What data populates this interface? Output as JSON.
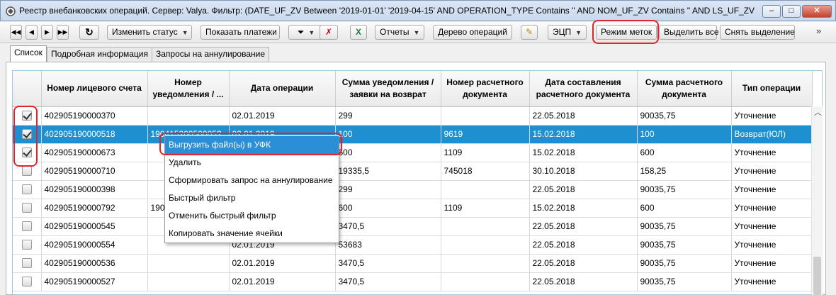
{
  "window": {
    "title": "Реестр внебанковских операций. Сервер: Valya. Фильтр: (DATE_UF_ZV Between '2019-01-01' '2019-04-15' AND OPERATION_TYPE Contains '' AND NOM_UF_ZV Contains '' AND LS_UF_ZV Contai...",
    "minimize": "‒",
    "maximize": "□",
    "close": "✕"
  },
  "toolbar": {
    "first": "◀◀",
    "prev": "◀",
    "next": "▶",
    "last": "▶▶",
    "refresh_icon": "↻",
    "change_status": "Изменить статус",
    "show_payments": "Показать платежи",
    "filter_icon": "⏷",
    "clear_filter_icon": "✗",
    "export_icon": "X",
    "reports": "Отчеты",
    "operation_tree": "Дерево операций",
    "sign_icon": "✎",
    "ecp": "ЭЦП",
    "mark_mode": "Режим меток",
    "select_all": "Выделить все",
    "deselect": "Снять выделение",
    "more": "»"
  },
  "tabs": [
    "Список",
    "Подробная информация",
    "Запросы на аннулирование"
  ],
  "grid": {
    "columns": [
      "",
      "Номер лицевого счета",
      "Номер уведомления / ...",
      "Дата операции",
      "Сумма уведомления / заявки на возврат",
      "Номер расчетного документа",
      "Дата составления расчетного документа",
      "Сумма расчетного документа",
      "Тип операции"
    ],
    "rows": [
      {
        "checked": true,
        "account": "402905190000370",
        "notice": "",
        "date": "02.01.2019",
        "amount": "299",
        "doc_num": "",
        "doc_date": "22.05.2018",
        "doc_sum": "90035,75",
        "type": "Уточнение"
      },
      {
        "checked": true,
        "account": "402905190000518",
        "notice": "19041520050005?",
        "date": "02.01.2019",
        "amount": "100",
        "doc_num": "9619",
        "doc_date": "15.02.2018",
        "doc_sum": "100",
        "type": "Возврат(ЮЛ)"
      },
      {
        "checked": true,
        "account": "402905190000673",
        "notice": "",
        "date": "",
        "amount": "600",
        "doc_num": "1109",
        "doc_date": "15.02.2018",
        "doc_sum": "600",
        "type": "Уточнение"
      },
      {
        "checked": false,
        "account": "402905190000710",
        "notice": "",
        "date": "",
        "amount": "19335,5",
        "doc_num": "745018",
        "doc_date": "30.10.2018",
        "doc_sum": "158,25",
        "type": "Уточнение"
      },
      {
        "checked": false,
        "account": "402905190000398",
        "notice": "",
        "date": "",
        "amount": "299",
        "doc_num": "",
        "doc_date": "22.05.2018",
        "doc_sum": "90035,75",
        "type": "Уточнение"
      },
      {
        "checked": false,
        "account": "402905190000792",
        "notice": "190",
        "date": "",
        "amount": "600",
        "doc_num": "1109",
        "doc_date": "15.02.2018",
        "doc_sum": "600",
        "type": "Уточнение"
      },
      {
        "checked": false,
        "account": "402905190000545",
        "notice": "",
        "date": "",
        "amount": "3470,5",
        "doc_num": "",
        "doc_date": "22.05.2018",
        "doc_sum": "90035,75",
        "type": "Уточнение"
      },
      {
        "checked": false,
        "account": "402905190000554",
        "notice": "",
        "date": "02.01.2019",
        "amount": "53683",
        "doc_num": "",
        "doc_date": "22.05.2018",
        "doc_sum": "90035,75",
        "type": "Уточнение"
      },
      {
        "checked": false,
        "account": "402905190000536",
        "notice": "",
        "date": "02.01.2019",
        "amount": "3470,5",
        "doc_num": "",
        "doc_date": "22.05.2018",
        "doc_sum": "90035,75",
        "type": "Уточнение"
      },
      {
        "checked": false,
        "account": "402905190000527",
        "notice": "",
        "date": "02.01.2019",
        "amount": "3470,5",
        "doc_num": "",
        "doc_date": "22.05.2018",
        "doc_sum": "90035,75",
        "type": "Уточнение"
      }
    ]
  },
  "context_menu": {
    "items": [
      "Выгрузить файл(ы) в УФК",
      "Удалить",
      "Сформировать запрос на аннулирование",
      "Быстрый фильтр",
      "Отменить быстрый фильтр",
      "Копировать значение ячейки"
    ]
  },
  "colors": {
    "selection": "#1e8fd1",
    "menu_hover": "#2a8fd6",
    "annotation": "#e0242b"
  }
}
